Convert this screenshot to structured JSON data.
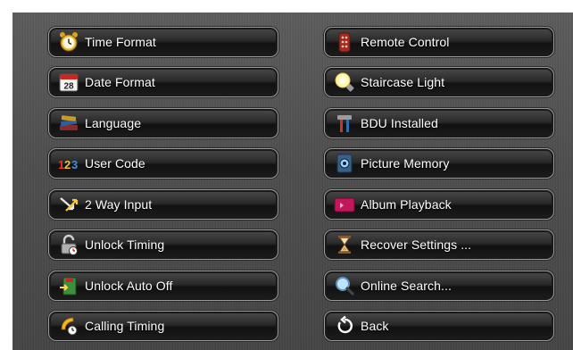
{
  "left_menu": [
    {
      "label": "Time Format",
      "icon": "alarm-clock-icon"
    },
    {
      "label": "Date Format",
      "icon": "calendar-icon"
    },
    {
      "label": "Language",
      "icon": "books-icon"
    },
    {
      "label": "User Code",
      "icon": "numbers-123-icon"
    },
    {
      "label": "2 Way Input",
      "icon": "two-way-arrows-icon"
    },
    {
      "label": "Unlock Timing",
      "icon": "padlock-timer-icon"
    },
    {
      "label": "Unlock Auto Off",
      "icon": "exit-door-icon"
    },
    {
      "label": "Calling Timing",
      "icon": "handset-timer-icon"
    }
  ],
  "right_menu": [
    {
      "label": "Remote Control",
      "icon": "remote-control-icon"
    },
    {
      "label": "Staircase Light",
      "icon": "light-bulb-icon"
    },
    {
      "label": "BDU Installed",
      "icon": "tools-icon"
    },
    {
      "label": "Picture Memory",
      "icon": "camera-memory-icon"
    },
    {
      "label": "Album Playback",
      "icon": "photo-album-icon"
    },
    {
      "label": "Recover Settings ...",
      "icon": "hourglass-icon"
    },
    {
      "label": "Online Search...",
      "icon": "magnifier-icon"
    },
    {
      "label": "Back",
      "icon": "back-arrow-icon"
    }
  ],
  "colors": {
    "panel_background": "#4d4d4d",
    "button_text": "#ffffff",
    "button_border": "#9a9a9a"
  }
}
